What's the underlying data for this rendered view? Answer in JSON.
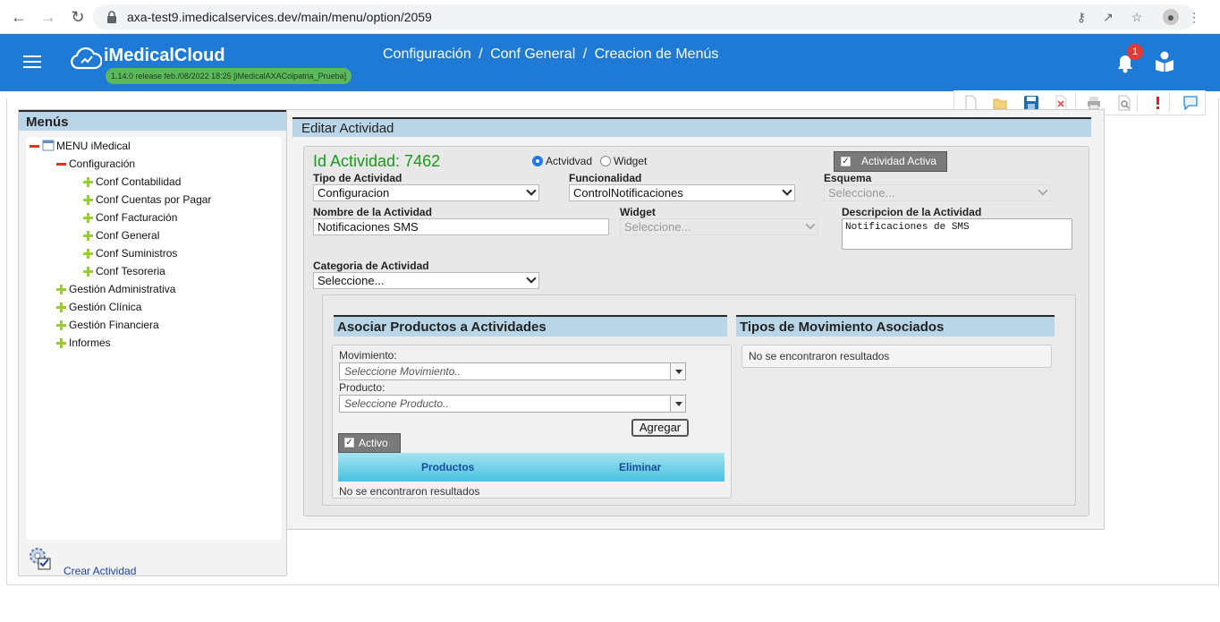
{
  "browser": {
    "url": "axa-test9.imedicalservices.dev/main/menu/option/2059"
  },
  "header": {
    "app_name": "iMedicalCloud",
    "version": "1.14.0 release feb./08/2022 18:25 [iMedicalAXAColpatria_Prueba]",
    "breadcrumb": [
      "Configuración",
      "Conf General",
      "Creacion de Menús"
    ],
    "separator": "/",
    "notifications_count": "1",
    "brand_color": "#1e7ad5"
  },
  "toolbar": {
    "buttons": [
      "new-icon",
      "open-folder-icon",
      "save-icon",
      "delete-icon",
      "print-icon",
      "search-icon",
      "alert-icon",
      "comment-icon"
    ]
  },
  "sidebar": {
    "title": "Menús",
    "root": "MENU iMedical",
    "items": [
      {
        "label": "Configuración",
        "expanded": true,
        "children": [
          "Conf Contabilidad",
          "Conf Cuentas por Pagar",
          "Conf Facturación",
          "Conf General",
          "Conf Suministros",
          "Conf Tesoreria"
        ]
      },
      {
        "label": "Gestión Administrativa",
        "expanded": false
      },
      {
        "label": "Gestión Clínica",
        "expanded": false
      },
      {
        "label": "Gestión Financiera",
        "expanded": false
      },
      {
        "label": "Informes",
        "expanded": false
      }
    ],
    "create_link": "Crear Actividad"
  },
  "form": {
    "section_title": "Editar Actividad",
    "id_title": "Id Actividad: 7462",
    "radio_actividad": "Actvidvad",
    "radio_widget": "Widget",
    "active_button": "Actividad Activa",
    "tipo_label": "Tipo de Actividad",
    "tipo_value": "Configuracion",
    "funcionalidad_label": "Funcionalidad",
    "funcionalidad_value": "ControlNotificaciones",
    "esquema_label": "Esquema",
    "esquema_value": "Seleccione...",
    "nombre_label": "Nombre de la Actividad",
    "nombre_value": "Notificaciones SMS",
    "widget_label": "Widget",
    "widget_value": "Seleccione...",
    "descripcion_label": "Descripcion de la Actividad",
    "descripcion_value": "Notificaciones de SMS",
    "categoria_label": "Categoria de Actividad",
    "categoria_value": "Seleccione..."
  },
  "productos": {
    "title": "Asociar Productos a Actividades",
    "movimiento_label": "Movimiento:",
    "movimiento_placeholder": "Seleccione Movimiento..",
    "producto_label": "Producto:",
    "producto_placeholder": "Seleccione Producto..",
    "agregar_button": "Agregar",
    "activo_button": "Activo",
    "col_productos": "Productos",
    "col_eliminar": "Eliminar",
    "no_results": "No se encontraron resultados"
  },
  "movimientos": {
    "title": "Tipos de Movimiento Asociados",
    "no_results": "No se encontraron resultados"
  }
}
